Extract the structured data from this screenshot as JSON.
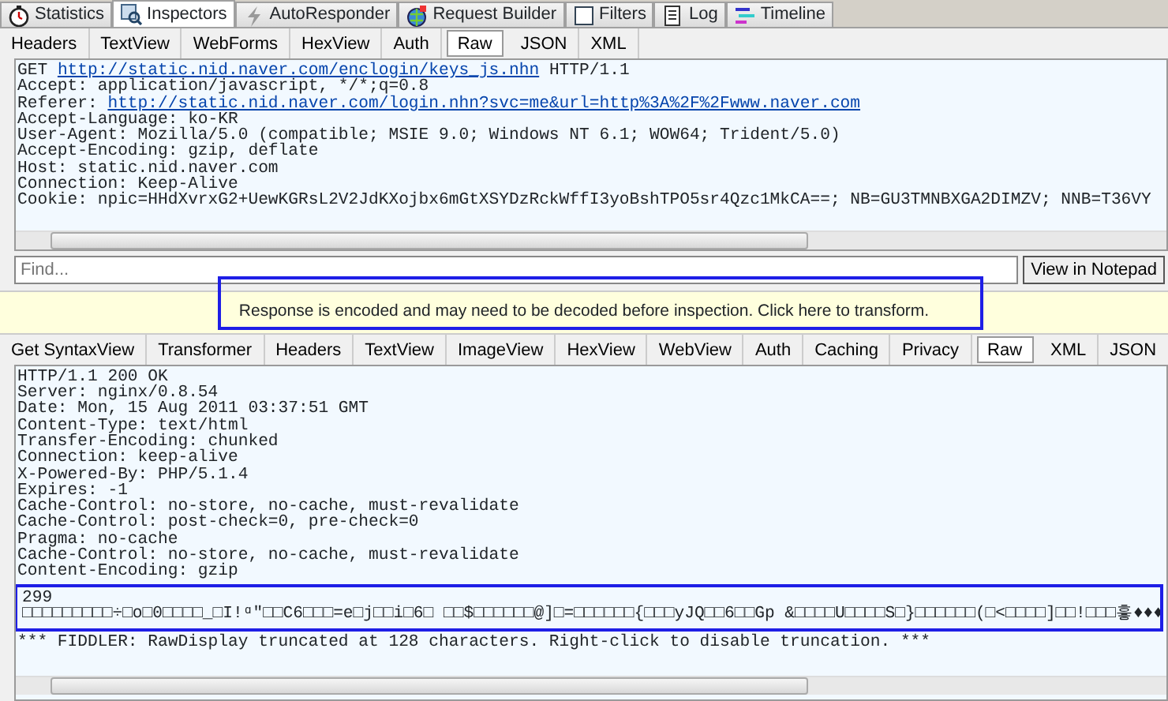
{
  "main_tabs": [
    {
      "label": "Statistics",
      "selected": false
    },
    {
      "label": "Inspectors",
      "selected": true
    },
    {
      "label": "AutoResponder",
      "selected": false
    },
    {
      "label": "Request Builder",
      "selected": false
    },
    {
      "label": "Filters",
      "selected": false
    },
    {
      "label": "Log",
      "selected": false
    },
    {
      "label": "Timeline",
      "selected": false
    }
  ],
  "request": {
    "tabs": [
      {
        "label": "Headers",
        "selected": false
      },
      {
        "label": "TextView",
        "selected": false
      },
      {
        "label": "WebForms",
        "selected": false
      },
      {
        "label": "HexView",
        "selected": false
      },
      {
        "label": "Auth",
        "selected": false
      },
      {
        "label": "Raw",
        "selected": true
      },
      {
        "label": "JSON",
        "selected": false
      },
      {
        "label": "XML",
        "selected": false
      }
    ],
    "lines": [
      {
        "text": "GET ",
        "link": "http://static.nid.naver.com/enclogin/keys_js.nhn",
        "after": " HTTP/1.1"
      },
      {
        "text": "Accept: application/javascript, */*;q=0.8"
      },
      {
        "text": "Referer: ",
        "link": "http://static.nid.naver.com/login.nhn?svc=me&url=http%3A%2F%2Fwww.naver.com"
      },
      {
        "text": "Accept-Language: ko-KR"
      },
      {
        "text": "User-Agent: Mozilla/5.0 (compatible; MSIE 9.0; Windows NT 6.1; WOW64; Trident/5.0)"
      },
      {
        "text": "Accept-Encoding: gzip, deflate"
      },
      {
        "text": "Host: static.nid.naver.com"
      },
      {
        "text": "Connection: Keep-Alive"
      },
      {
        "text": "Cookie: npic=HHdXvrxG2+UewKGRsL2V2JdKXojbx6mGtXSYDzRckWffI3yoBshTPO5sr4Qzc1MkCA==; NB=GU3TMNBXGA2DIMZV; NNB=T36VY"
      }
    ],
    "find": {
      "placeholder": "Find..."
    },
    "notepad_button": "View in Notepad"
  },
  "banner": {
    "text": "Response is encoded and may need to be decoded before inspection. Click here to transform.",
    "highlighted": true
  },
  "response": {
    "tabs": [
      {
        "label": "Get SyntaxView",
        "selected": false
      },
      {
        "label": "Transformer",
        "selected": false
      },
      {
        "label": "Headers",
        "selected": false
      },
      {
        "label": "TextView",
        "selected": false
      },
      {
        "label": "ImageView",
        "selected": false
      },
      {
        "label": "HexView",
        "selected": false
      },
      {
        "label": "WebView",
        "selected": false
      },
      {
        "label": "Auth",
        "selected": false
      },
      {
        "label": "Caching",
        "selected": false
      },
      {
        "label": "Privacy",
        "selected": false
      },
      {
        "label": "Raw",
        "selected": true
      },
      {
        "label": "XML",
        "selected": false
      },
      {
        "label": "JSON",
        "selected": false
      }
    ],
    "lines": [
      "HTTP/1.1 200 OK",
      "Server: nginx/0.8.54",
      "Date: Mon, 15 Aug 2011 03:37:51 GMT",
      "Content-Type: text/html",
      "Transfer-Encoding: chunked",
      "Connection: keep-alive",
      "X-Powered-By: PHP/5.1.4",
      "Expires: -1",
      "Cache-Control: no-store, no-cache, must-revalidate",
      "Cache-Control: post-check=0, pre-check=0",
      "Pragma: no-cache",
      "Cache-Control: no-store, no-cache, must-revalidate",
      "Content-Encoding: gzip"
    ],
    "body": {
      "highlighted": true,
      "lines": [
        "299",
        "□□□□□□□□□÷□o□0□□□□_□I!ᵅ\"□□C6□□□=e□j□□i□6□ □□$□□□□□□@]□=□□□□□□{□□□yJQ□□6□□Gp &□□□□U□□□□S□}□□□□□□(□<□□□□]□□!□□□흫♦♦♦"
      ]
    },
    "note": "*** FIDDLER: RawDisplay truncated at 128 characters. Right-click to disable truncation. ***"
  }
}
